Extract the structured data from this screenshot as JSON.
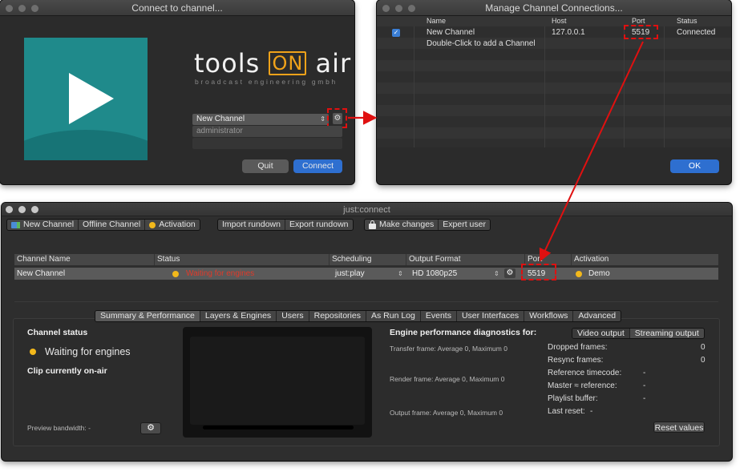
{
  "connect_dialog": {
    "title": "Connect to channel...",
    "brand_left": "tools",
    "brand_on": "ON",
    "brand_right": "air",
    "tagline": "broadcast engineering gmbh",
    "channel_select": "New Channel",
    "username": "administrator",
    "password_placeholder": "",
    "quit_label": "Quit",
    "connect_label": "Connect"
  },
  "manage_dialog": {
    "title": "Manage Channel Connections...",
    "columns": [
      "Name",
      "Host",
      "Port",
      "Status"
    ],
    "rows": [
      {
        "name": "New Channel",
        "host": "127.0.0.1",
        "port": "5519",
        "status": "Connected",
        "checked": true
      }
    ],
    "hint": "Double-Click to add a Channel",
    "ok_label": "OK"
  },
  "main_window": {
    "title": "just:connect",
    "toolbar": {
      "new_channel": "New Channel",
      "offline_channel": "Offline Channel",
      "activation": "Activation",
      "import_rundown": "Import rundown",
      "export_rundown": "Export rundown",
      "make_changes": "Make changes",
      "expert_user": "Expert user"
    },
    "channel_table": {
      "columns": [
        "Channel Name",
        "Status",
        "Scheduling",
        "Output Format",
        "Port",
        "Activation"
      ],
      "row": {
        "name": "New Channel",
        "status": "Waiting for engines",
        "scheduling": "just:play",
        "output_format": "HD 1080p25",
        "port": "5519",
        "activation": "Demo"
      }
    },
    "tabs": [
      "Summary & Performance",
      "Layers & Engines",
      "Users",
      "Repositories",
      "As Run Log",
      "Events",
      "User Interfaces",
      "Workflows",
      "Advanced"
    ],
    "summary": {
      "channel_status_label": "Channel status",
      "channel_status_value": "Waiting for engines",
      "clip_on_air_label": "Clip currently on-air",
      "preview_bandwidth": "Preview bandwidth:",
      "preview_bandwidth_value": "-",
      "diag_title": "Engine performance diagnostics for:",
      "video_output": "Video output",
      "streaming_output": "Streaming output",
      "transfer_frame": "Transfer frame: Average 0, Maximum 0",
      "render_frame": "Render frame: Average 0, Maximum 0",
      "output_frame": "Output frame: Average 0, Maximum 0",
      "stats": [
        {
          "label": "Dropped frames:",
          "value": "0"
        },
        {
          "label": "Resync frames:",
          "value": "0"
        },
        {
          "label": "Reference timecode:",
          "value": "-"
        },
        {
          "label": "Master ≈ reference:",
          "value": "-"
        },
        {
          "label": "Playlist buffer:",
          "value": "-"
        },
        {
          "label": "Last reset:",
          "value": "-"
        }
      ],
      "reset_values": "Reset values"
    }
  },
  "colors": {
    "accent_blue": "#2e6fd0",
    "status_yellow": "#f2b81b",
    "status_red": "#e03a2a",
    "highlight_red": "#e01010",
    "brand_teal": "#1f8a8b",
    "brand_orange": "#f0a21a"
  },
  "icons": [
    "gear-icon",
    "play-icon",
    "flag-icon",
    "lock-icon",
    "checkbox-icon",
    "chevron-updown-icon"
  ]
}
